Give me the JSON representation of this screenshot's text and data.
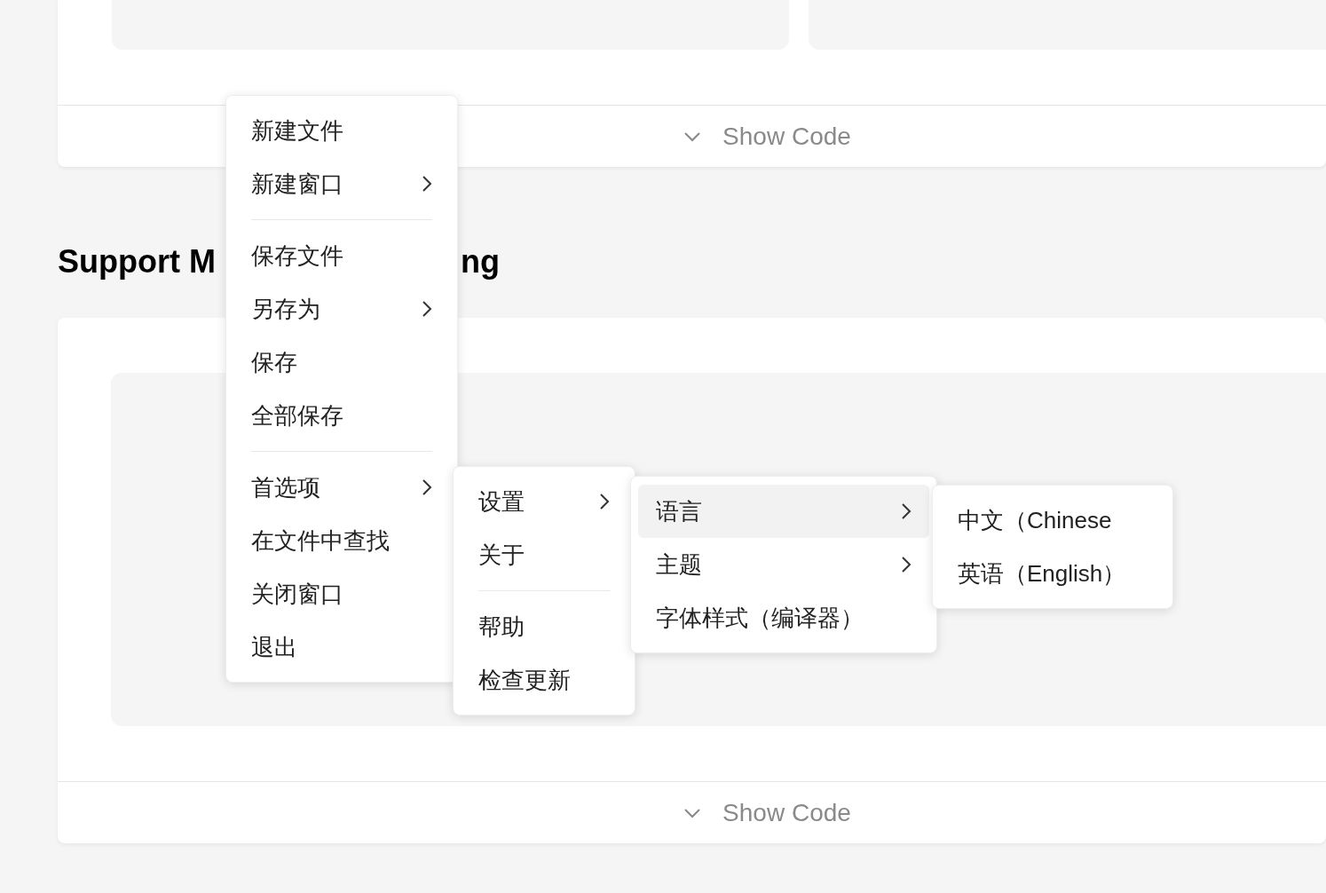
{
  "top_demo": {
    "show_code": "Show Code"
  },
  "section_heading": {
    "visible_start": "Support M",
    "visible_end": "ng"
  },
  "bottom_demo": {
    "show_code": "Show Code"
  },
  "menus": [
    {
      "items": [
        {
          "kind": "item",
          "label": "新建文件",
          "submenu": false,
          "highlighted": false
        },
        {
          "kind": "item",
          "label": "新建窗口",
          "submenu": true,
          "highlighted": false
        },
        {
          "kind": "divider"
        },
        {
          "kind": "item",
          "label": "保存文件",
          "submenu": false,
          "highlighted": false
        },
        {
          "kind": "item",
          "label": "另存为",
          "submenu": true,
          "highlighted": false
        },
        {
          "kind": "item",
          "label": "保存",
          "submenu": false,
          "highlighted": false
        },
        {
          "kind": "item",
          "label": "全部保存",
          "submenu": false,
          "highlighted": false
        },
        {
          "kind": "divider"
        },
        {
          "kind": "item",
          "label": "首选项",
          "submenu": true,
          "highlighted": false
        },
        {
          "kind": "item",
          "label": "在文件中查找",
          "submenu": false,
          "highlighted": false
        },
        {
          "kind": "item",
          "label": "关闭窗口",
          "submenu": false,
          "highlighted": false
        },
        {
          "kind": "item",
          "label": "退出",
          "submenu": false,
          "highlighted": false
        }
      ]
    },
    {
      "items": [
        {
          "kind": "item",
          "label": "设置",
          "submenu": true,
          "highlighted": false
        },
        {
          "kind": "item",
          "label": "关于",
          "submenu": false,
          "highlighted": false
        },
        {
          "kind": "divider"
        },
        {
          "kind": "item",
          "label": "帮助",
          "submenu": false,
          "highlighted": false
        },
        {
          "kind": "item",
          "label": "检查更新",
          "submenu": false,
          "highlighted": false
        }
      ]
    },
    {
      "items": [
        {
          "kind": "item",
          "label": "语言",
          "submenu": true,
          "highlighted": true
        },
        {
          "kind": "item",
          "label": "主题",
          "submenu": true,
          "highlighted": false
        },
        {
          "kind": "item",
          "label": "字体样式（编译器）",
          "submenu": false,
          "highlighted": false
        }
      ]
    },
    {
      "items": [
        {
          "kind": "item",
          "label": "中文（Chinese",
          "submenu": false,
          "highlighted": false
        },
        {
          "kind": "item",
          "label": "英语（English）",
          "submenu": false,
          "highlighted": false
        }
      ]
    }
  ]
}
